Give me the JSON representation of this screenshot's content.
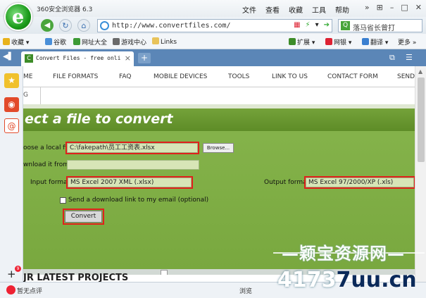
{
  "window": {
    "app_title": "360安全浏览器 6.3",
    "menu": [
      "文件",
      "查看",
      "收藏",
      "工具",
      "帮助"
    ],
    "controls": [
      "»",
      "⊞",
      "–",
      "□",
      "✕"
    ]
  },
  "toolbar": {
    "url": "http://www.convertfiles.com/",
    "search_placeholder": "落马省长曾打"
  },
  "bookmarks": [
    {
      "label": "收藏",
      "color": "#e8b21c"
    },
    {
      "label": "谷歌",
      "color": "#4a8fd8"
    },
    {
      "label": "网址大全",
      "color": "#3d9a35"
    },
    {
      "label": "游戏中心",
      "color": "#6a6a6a"
    },
    {
      "label": "Links",
      "color": "#e8c35a"
    }
  ],
  "bookmarks_right": [
    "扩展",
    "网银",
    "翻译",
    "更多"
  ],
  "tab": {
    "label": "Convert Files - free online",
    "close": "×",
    "new_tab": "+"
  },
  "site_nav": [
    "ME",
    "FILE FORMATS",
    "FAQ",
    "MOBILE DEVICES",
    "TOOLS",
    "LINK TO US",
    "CONTACT FORM",
    "SEND"
  ],
  "sub_nav_label": "G",
  "panel": {
    "title": "ect a file to convert",
    "local_file_label": "oose a local file:",
    "local_file_value": "C:\\fakepath\\员工工资表.xlsx",
    "browse_label": "Browse...",
    "download_label": "wnload it from:",
    "input_format_label": "Input format:",
    "input_format_value": "MS Excel 2007 XML (.xlsx)",
    "output_format_label": "Output format:",
    "output_format_value": "MS Excel 97/2000/XP (.xls)",
    "email_label": "Send a download link to my email (optional)",
    "convert_label": "Convert"
  },
  "projects_title": "JR LATEST PROJECTS",
  "status": {
    "left": "暂无点评",
    "right": "浏览",
    "badge": "9"
  },
  "watermark": {
    "top": "—颖宝资源网—",
    "bottom_a": "4173",
    "bottom_b": "7uu.cn"
  }
}
